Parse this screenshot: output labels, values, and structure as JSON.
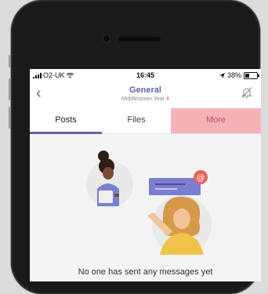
{
  "status_bar": {
    "carrier": "O2-UK",
    "time": "16:45",
    "battery": "38%",
    "battery_level": 0.38
  },
  "header": {
    "title": "General",
    "subtitle": "Middlestown Year 4"
  },
  "tabs": [
    {
      "label": "Posts",
      "selected": true
    },
    {
      "label": "Files",
      "selected": false
    },
    {
      "label": "More",
      "selected": false
    }
  ],
  "empty_state": {
    "message": "No one has sent any messages yet"
  },
  "colors": {
    "accent": "#6264a7",
    "highlight": "#f6b3b7",
    "mention_badge": "#e8625a"
  },
  "icons": [
    "back-chevron-icon",
    "bell-muted-icon",
    "signal-icon",
    "wifi-icon",
    "location-arrow-icon",
    "battery-icon",
    "at-mention-icon"
  ]
}
